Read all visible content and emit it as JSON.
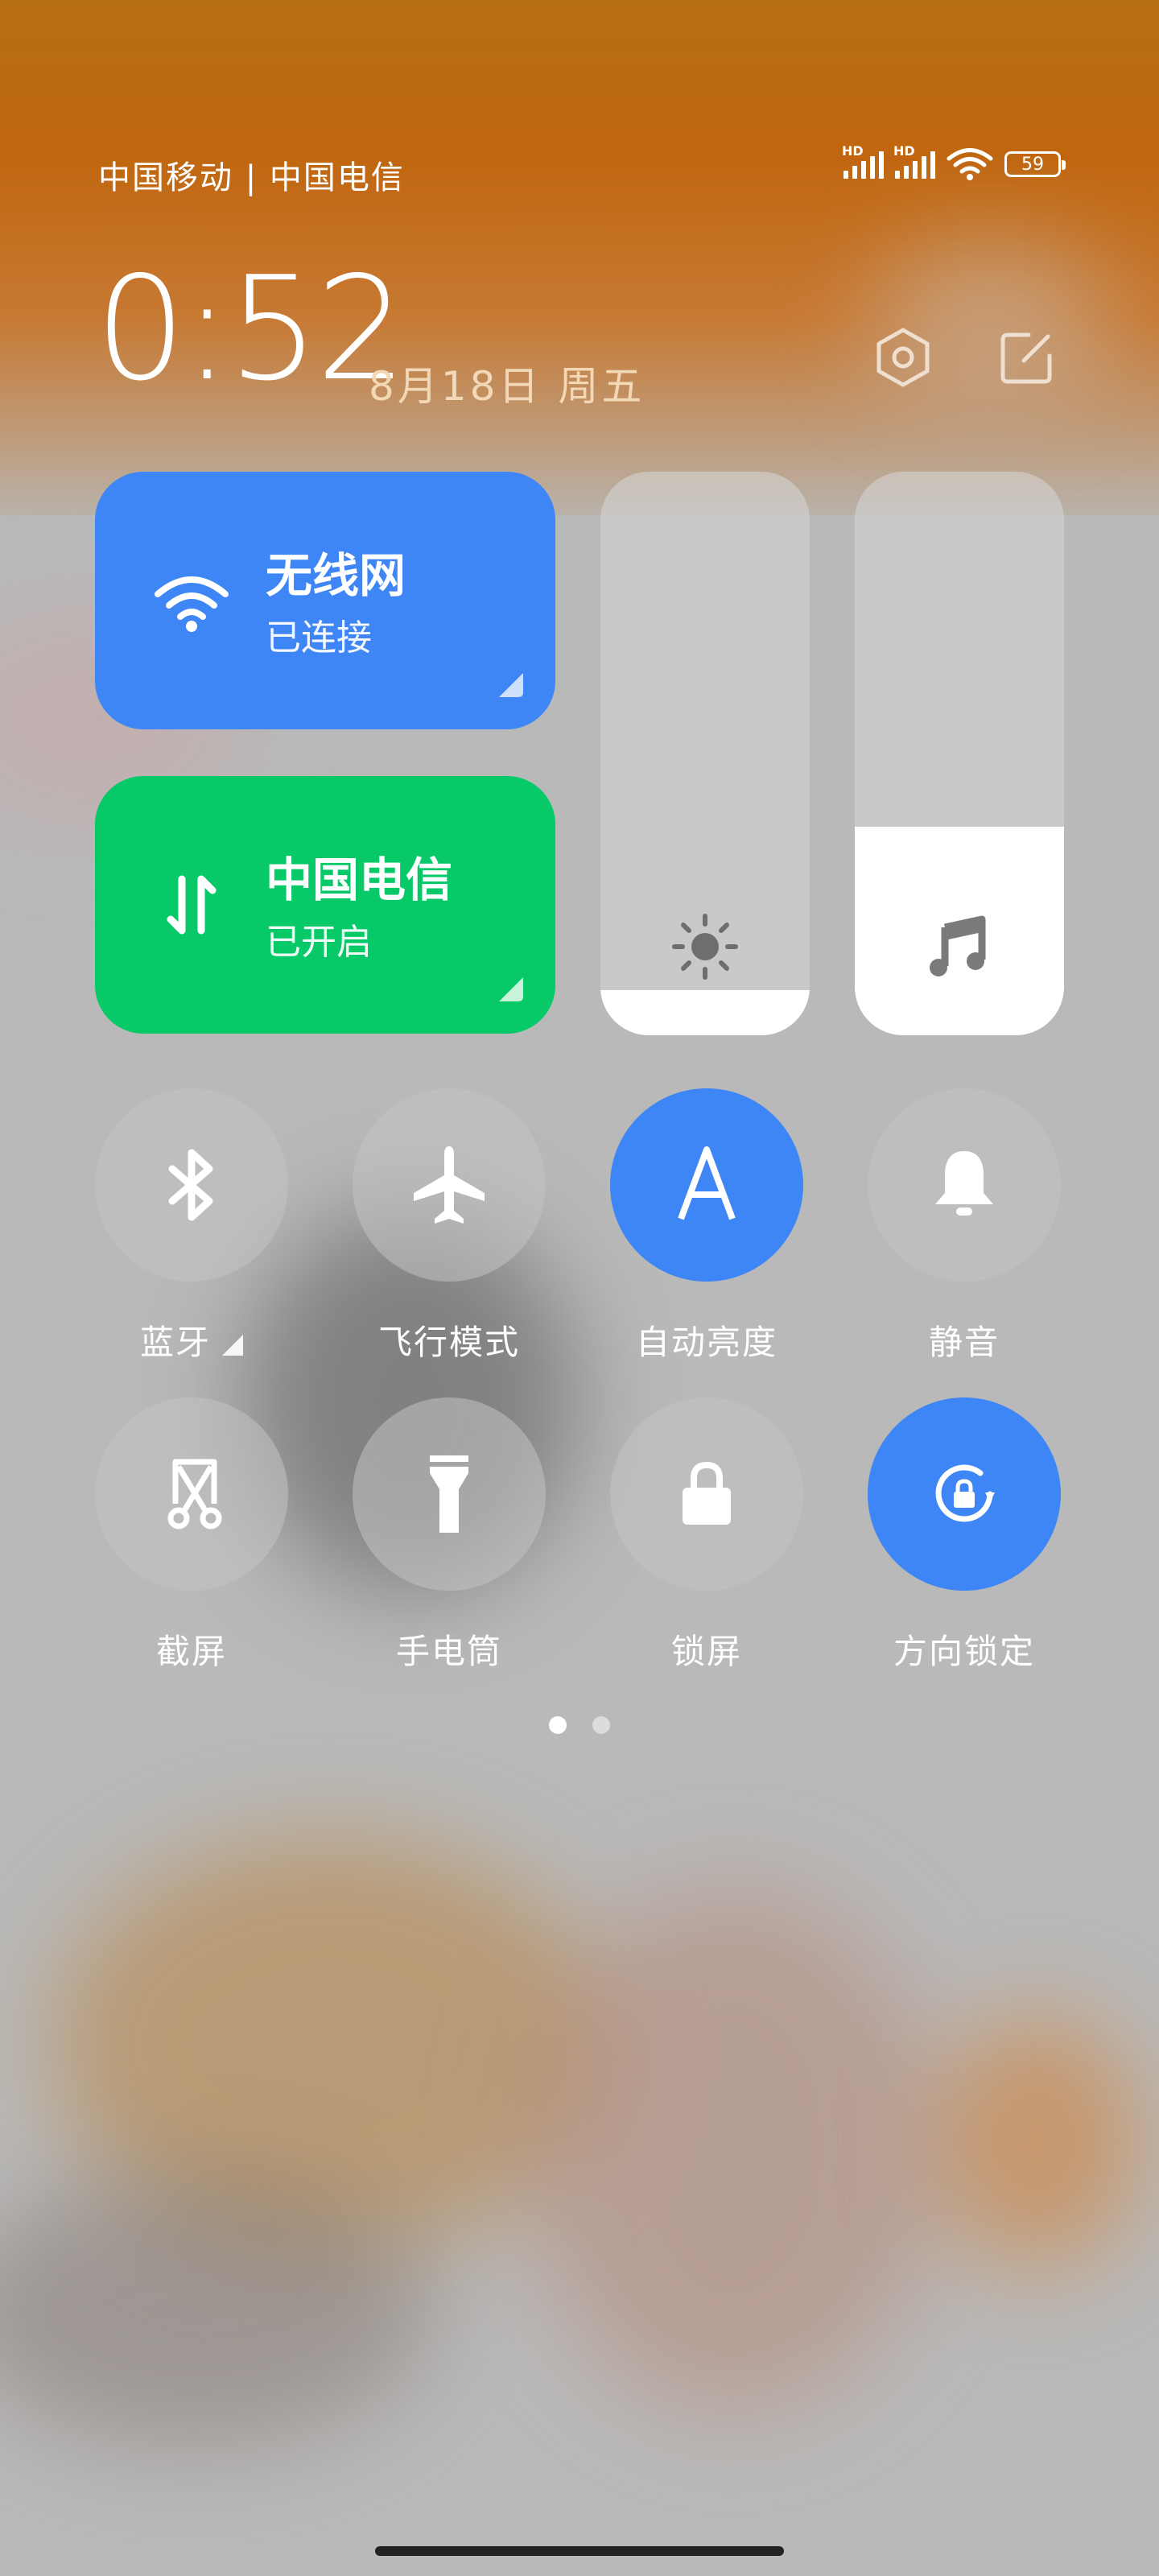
{
  "status_bar": {
    "carriers": "中国移动 | 中国电信",
    "signal1_label": "HD",
    "signal2_label": "HD",
    "battery": "59"
  },
  "header": {
    "time": "0:52",
    "date": "8月18日 周五",
    "settings_icon": "hexagon-settings-icon",
    "edit_icon": "edit-icon"
  },
  "tiles": {
    "wifi": {
      "title": "无线网",
      "status": "已连接",
      "color": "#3e86f5"
    },
    "mobile_data": {
      "title": "中国电信",
      "status": "已开启",
      "color": "#07c968"
    }
  },
  "sliders": {
    "brightness": {
      "level": 0.08,
      "icon": "sun-icon"
    },
    "volume": {
      "level": 0.37,
      "icon": "music-note-icon"
    }
  },
  "toggles": [
    {
      "label": "蓝牙",
      "icon": "bluetooth-icon",
      "active": false
    },
    {
      "label": "飞行模式",
      "icon": "airplane-icon",
      "active": false
    },
    {
      "label": "自动亮度",
      "icon": "auto-brightness-icon",
      "active": true
    },
    {
      "label": "静音",
      "icon": "bell-icon",
      "active": false
    },
    {
      "label": "截屏",
      "icon": "screenshot-icon",
      "active": false
    },
    {
      "label": "手电筒",
      "icon": "flashlight-icon",
      "active": false
    },
    {
      "label": "锁屏",
      "icon": "lock-icon",
      "active": false
    },
    {
      "label": "方向锁定",
      "icon": "rotation-lock-icon",
      "active": true
    }
  ],
  "pager": {
    "pages": 2,
    "current": 1
  },
  "accent_color": "#3e86f5"
}
